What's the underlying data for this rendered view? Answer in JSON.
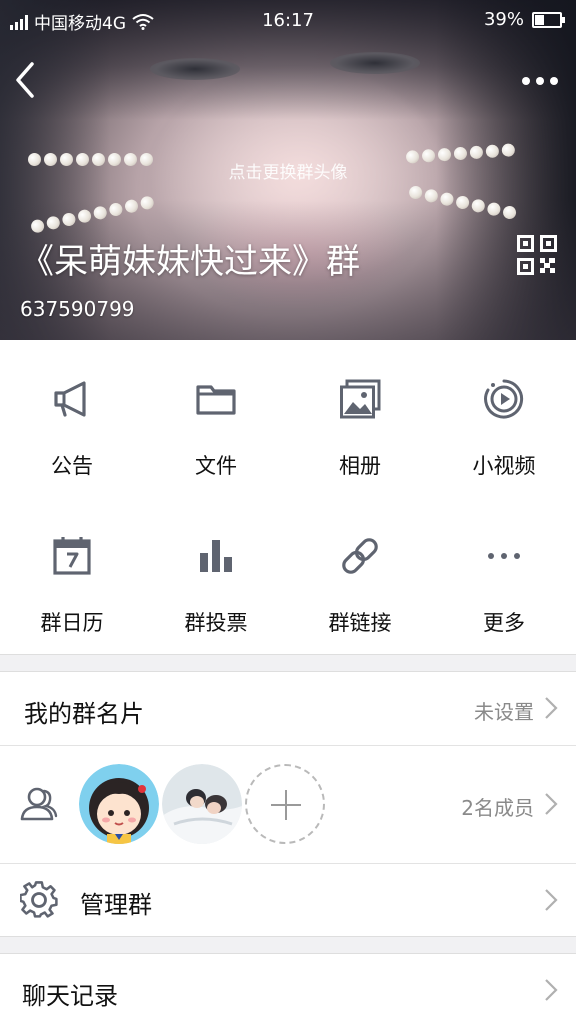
{
  "status_bar": {
    "carrier": "中国移动4G",
    "time": "16:17",
    "battery": "39%",
    "battery_level": 0.39
  },
  "header": {
    "back_icon": "chevron-left-icon",
    "more_icon": "more-dots-icon",
    "change_avatar_hint": "点击更换群头像",
    "group_name": "《呆萌妹妹快过来》群",
    "group_id": "637590799",
    "qr_icon": "qr-code-icon"
  },
  "features": [
    {
      "label": "公告",
      "icon": "megaphone-icon"
    },
    {
      "label": "文件",
      "icon": "folder-icon"
    },
    {
      "label": "相册",
      "icon": "album-icon"
    },
    {
      "label": "小视频",
      "icon": "video-play-icon"
    },
    {
      "label": "群日历",
      "icon": "calendar-icon"
    },
    {
      "label": "群投票",
      "icon": "bar-chart-icon"
    },
    {
      "label": "群链接",
      "icon": "link-icon"
    },
    {
      "label": "更多",
      "icon": "more-dots-icon"
    }
  ],
  "my_card": {
    "label": "我的群名片",
    "value": "未设置"
  },
  "members": {
    "icon": "members-icon",
    "count_text": "2名成员"
  },
  "manage": {
    "label": "管理群",
    "icon": "gear-icon"
  },
  "chat_history": {
    "label": "聊天记录"
  },
  "colors": {
    "icon_gray": "#5f6470",
    "divider": "#e3e3e3",
    "section_gap": "#f1f1f3",
    "secondary_text": "#8a8a8a"
  }
}
